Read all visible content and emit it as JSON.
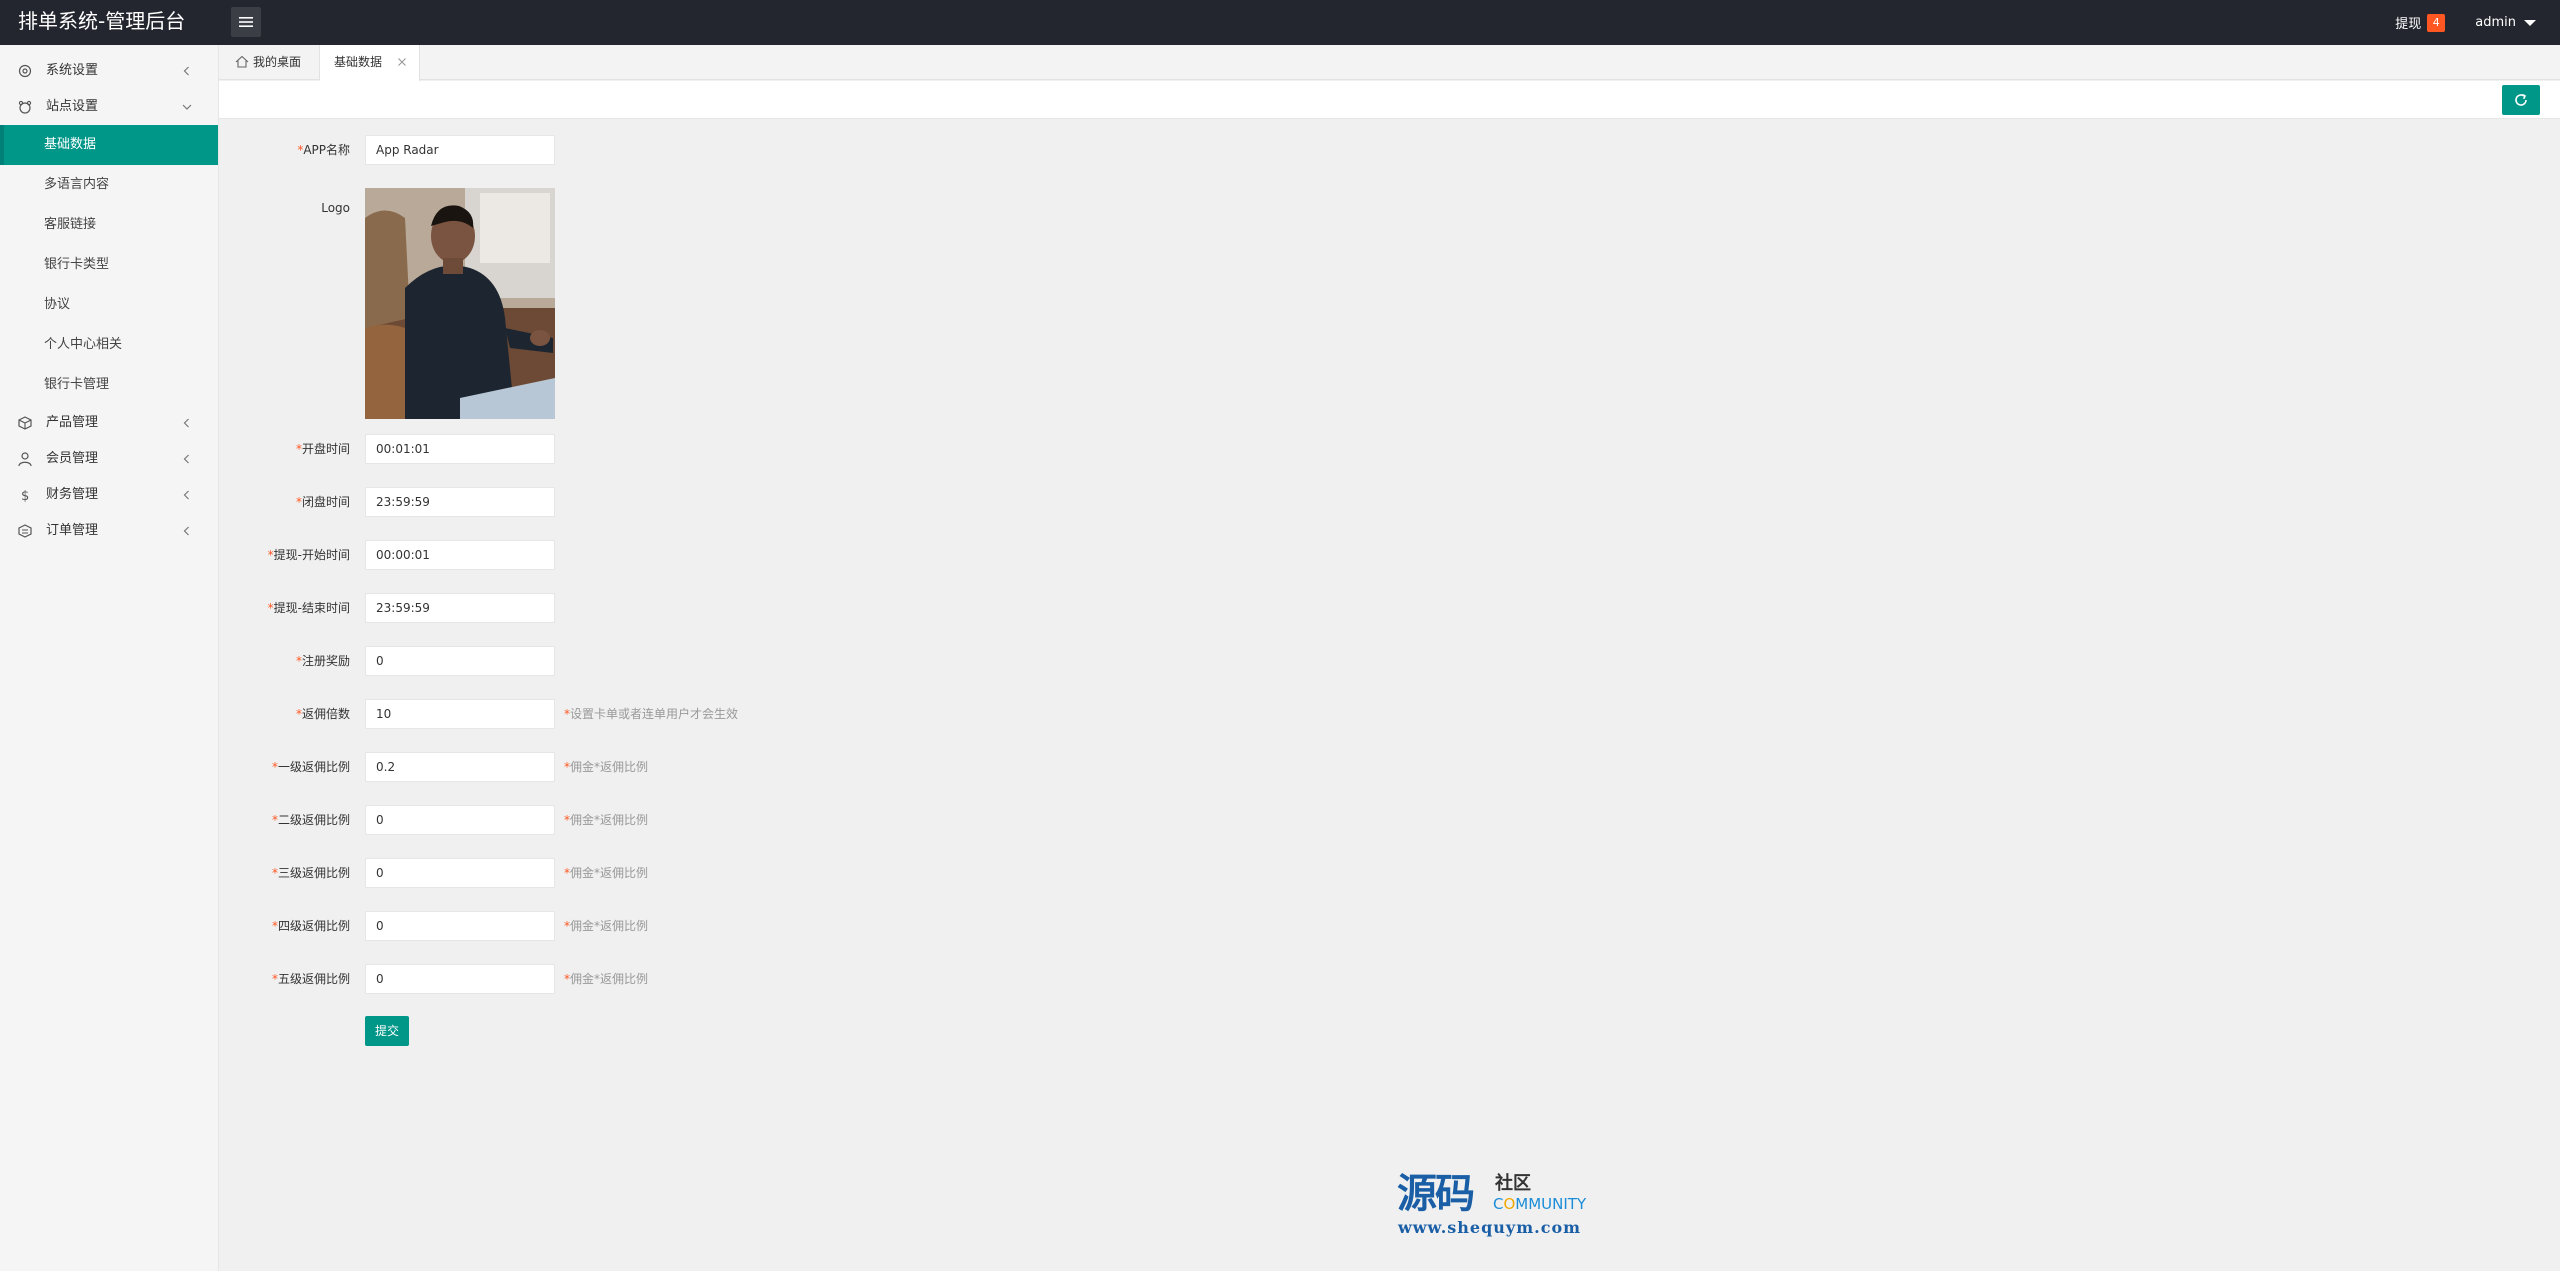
{
  "header": {
    "title": "排单系统-管理后台",
    "withdraw_label": "提现",
    "withdraw_badge": "4",
    "user": "admin"
  },
  "sidebar": {
    "groups": [
      {
        "label": "系统设置",
        "icon": "gear-icon"
      },
      {
        "label": "站点设置",
        "icon": "site-icon",
        "expanded": true
      }
    ],
    "sub_items": [
      {
        "label": "基础数据",
        "active": true
      },
      {
        "label": "多语言内容"
      },
      {
        "label": "客服链接"
      },
      {
        "label": "银行卡类型"
      },
      {
        "label": "协议"
      },
      {
        "label": "个人中心相关"
      },
      {
        "label": "银行卡管理"
      }
    ],
    "groups_after": [
      {
        "label": "产品管理",
        "icon": "box-icon"
      },
      {
        "label": "会员管理",
        "icon": "user-icon"
      },
      {
        "label": "财务管理",
        "icon": "dollar-icon"
      },
      {
        "label": "订单管理",
        "icon": "order-icon"
      }
    ]
  },
  "tabs": {
    "home": "我的桌面",
    "current": "基础数据"
  },
  "colors": {
    "accent": "#009688",
    "header_bg": "#23262e",
    "required": "#ff5722"
  },
  "form": {
    "app_name": {
      "label": "APP名称",
      "value": "App Radar"
    },
    "logo": {
      "label": "Logo"
    },
    "open_time": {
      "label": "开盘时间",
      "value": "00:01:01"
    },
    "close_time": {
      "label": "闭盘时间",
      "value": "23:59:59"
    },
    "withdraw_start": {
      "label": "提现-开始时间",
      "value": "00:00:01"
    },
    "withdraw_end": {
      "label": "提现-结束时间",
      "value": "23:59:59"
    },
    "register_reward": {
      "label": "注册奖励",
      "value": "0"
    },
    "commission_multiple": {
      "label": "返佣倍数",
      "value": "10",
      "hint": "设置卡单或者连单用户才会生效"
    },
    "level1": {
      "label": "一级返佣比例",
      "value": "0.2",
      "hint": "佣金*返佣比例"
    },
    "level2": {
      "label": "二级返佣比例",
      "value": "0",
      "hint": "佣金*返佣比例"
    },
    "level3": {
      "label": "三级返佣比例",
      "value": "0",
      "hint": "佣金*返佣比例"
    },
    "level4": {
      "label": "四级返佣比例",
      "value": "0",
      "hint": "佣金*返佣比例"
    },
    "level5": {
      "label": "五级返佣比例",
      "value": "0",
      "hint": "佣金*返佣比例"
    },
    "required_mark": "*",
    "submit_label": "提交"
  },
  "watermark": {
    "big": "源码",
    "small": "社区",
    "community_c": "C",
    "community_o": "O",
    "community_rest": "MMUNITY",
    "url": "www.shequym.com"
  }
}
